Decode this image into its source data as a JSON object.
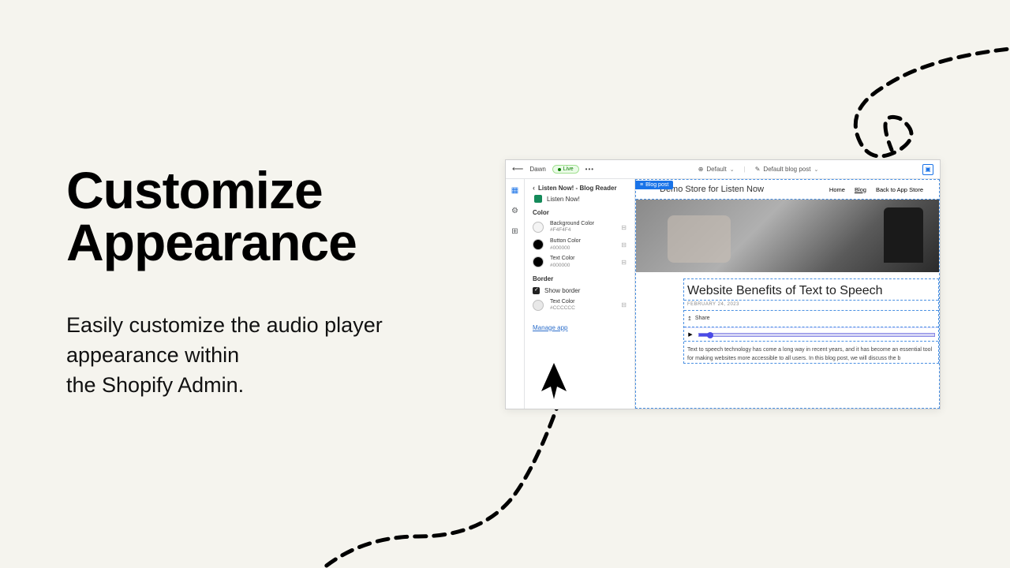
{
  "hero": {
    "title_line1": "Customize",
    "title_line2": "Appearance",
    "desc_line1": "Easily customize the audio player",
    "desc_line2": "appearance within",
    "desc_line3": "the Shopify Admin."
  },
  "topbar": {
    "theme": "Dawn",
    "live": "Live",
    "default": "Default",
    "blog_post": "Default blog post"
  },
  "panel": {
    "title": "Listen Now! - Blog Reader",
    "app_name": "Listen Now!",
    "color_section": "Color",
    "colors": [
      {
        "label": "Background Color",
        "hex": "#F4F4F4",
        "swatch": "#F4F4F4"
      },
      {
        "label": "Button Color",
        "hex": "#000000",
        "swatch": "#000000"
      },
      {
        "label": "Text Color",
        "hex": "#000000",
        "swatch": "#000000"
      }
    ],
    "border_section": "Border",
    "show_border": "Show border",
    "border_color": {
      "label": "Text Color",
      "hex": "#CCCCCC",
      "swatch": "#e8e8e8"
    },
    "manage_app": "Manage app"
  },
  "preview": {
    "badge": "Blog post",
    "store_name": "Demo Store for Listen Now",
    "nav": {
      "home": "Home",
      "blog": "Blog",
      "back": "Back to App Store"
    },
    "article_title": "Website Benefits of Text to Speech",
    "article_date": "February 24, 2023",
    "share": "Share",
    "body": "Text to speech technology has come a long way in recent years, and it has become an essential tool for making websites more accessible to all users. In this blog post, we will discuss the b"
  }
}
